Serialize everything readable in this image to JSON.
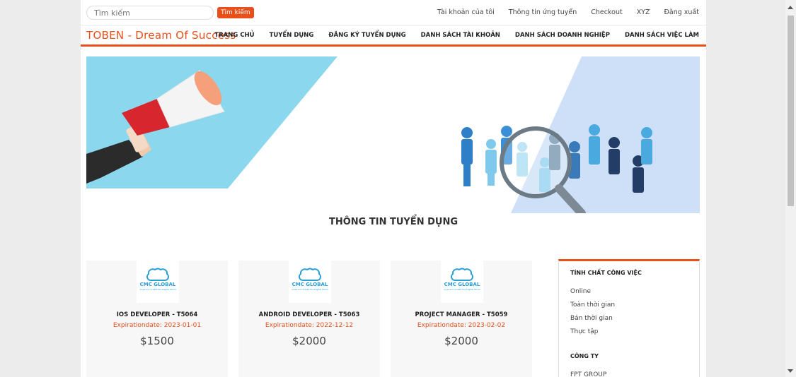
{
  "search": {
    "placeholder": "Tìm kiếm",
    "button_label": "Tìm kiếm"
  },
  "top_links": [
    "Tài khoản của tôi",
    "Thông tin ứng tuyển",
    "Checkout",
    "XYZ",
    "Đăng xuất"
  ],
  "brand": "TOBEN - Dream Of Success",
  "nav": [
    "TRANG CHỦ",
    "TUYỂN DỤNG",
    "ĐĂNG KÝ TUYỂN DỤNG",
    "DANH SÁCH TÀI KHOẢN",
    "DANH SÁCH DOANH NGHIỆP",
    "DANH SÁCH VIỆC LÀM"
  ],
  "section_title": "THÔNG TIN TUYỂN DỤNG",
  "jobs": [
    {
      "logo_text": "CMC GLOBAL",
      "logo_tagline": "Inspire to Create the Digital World",
      "title": "IOS DEVELOPER - T5064",
      "expiration": "Expirationdate: 2023-01-01",
      "salary": "$1500"
    },
    {
      "logo_text": "CMC GLOBAL",
      "logo_tagline": "Inspire to Create the Digital World",
      "title": "ANDROID DEVELOPER - T5063",
      "expiration": "Expirationdate: 2022-12-12",
      "salary": "$2000"
    },
    {
      "logo_text": "CMC GLOBAL",
      "logo_tagline": "Inspire to Create the Digital World",
      "title": "PROJECT MANAGER - T5059",
      "expiration": "Expirationdate: 2023-02-02",
      "salary": "$2000"
    }
  ],
  "sidebar": {
    "job_type_heading": "TÍNH CHẤT CÔNG VIỆC",
    "job_types": [
      "Online",
      "Toàn thời gian",
      "Bán thời gian",
      "Thực tập"
    ],
    "company_heading": "CÔNG TY",
    "companies": [
      "FPT GROUP"
    ]
  },
  "colors": {
    "accent": "#e8501b",
    "banner_left": "#8bd8ee",
    "banner_right": "#cde0f7",
    "people_blue": "#2f7ec8"
  }
}
